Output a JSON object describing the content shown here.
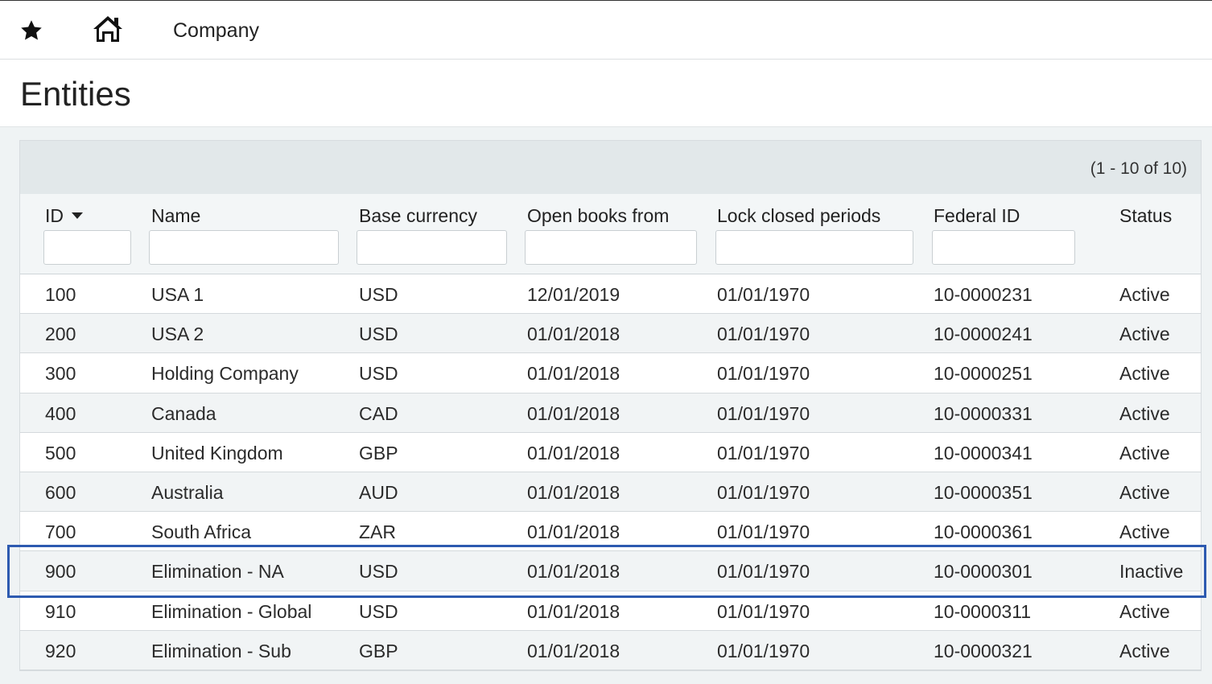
{
  "topbar": {
    "favorites_icon": "star-icon",
    "home_icon": "home-icon",
    "breadcrumb": "Company"
  },
  "page": {
    "title": "Entities"
  },
  "grid": {
    "pager_text": "(1 - 10 of 10)",
    "columns": [
      {
        "label": "ID",
        "sorted": "descending",
        "filter": true
      },
      {
        "label": "Name",
        "filter": true
      },
      {
        "label": "Base currency",
        "filter": true
      },
      {
        "label": "Open books from",
        "filter": true
      },
      {
        "label": "Lock closed periods",
        "filter": true
      },
      {
        "label": "Federal ID",
        "filter": true
      },
      {
        "label": "Status",
        "filter": false
      }
    ],
    "filters": {
      "id": "",
      "name": "",
      "base_currency": "",
      "open_books_from": "",
      "lock_closed_periods": "",
      "federal_id": ""
    },
    "rows": [
      {
        "id": "100",
        "name": "USA 1",
        "currency": "USD",
        "open": "12/01/2019",
        "lock": "01/01/1970",
        "federal_id": "10-0000231",
        "status": "Active"
      },
      {
        "id": "200",
        "name": "USA 2",
        "currency": "USD",
        "open": "01/01/2018",
        "lock": "01/01/1970",
        "federal_id": "10-0000241",
        "status": "Active"
      },
      {
        "id": "300",
        "name": "Holding Company",
        "currency": "USD",
        "open": "01/01/2018",
        "lock": "01/01/1970",
        "federal_id": "10-0000251",
        "status": "Active"
      },
      {
        "id": "400",
        "name": "Canada",
        "currency": "CAD",
        "open": "01/01/2018",
        "lock": "01/01/1970",
        "federal_id": "10-0000331",
        "status": "Active"
      },
      {
        "id": "500",
        "name": "United Kingdom",
        "currency": "GBP",
        "open": "01/01/2018",
        "lock": "01/01/1970",
        "federal_id": "10-0000341",
        "status": "Active"
      },
      {
        "id": "600",
        "name": "Australia",
        "currency": "AUD",
        "open": "01/01/2018",
        "lock": "01/01/1970",
        "federal_id": "10-0000351",
        "status": "Active"
      },
      {
        "id": "700",
        "name": "South Africa",
        "currency": "ZAR",
        "open": "01/01/2018",
        "lock": "01/01/1970",
        "federal_id": "10-0000361",
        "status": "Active"
      },
      {
        "id": "900",
        "name": "Elimination - NA",
        "currency": "USD",
        "open": "01/01/2018",
        "lock": "01/01/1970",
        "federal_id": "10-0000301",
        "status": "Inactive"
      },
      {
        "id": "910",
        "name": "Elimination - Global",
        "currency": "USD",
        "open": "01/01/2018",
        "lock": "01/01/1970",
        "federal_id": "10-0000311",
        "status": "Active"
      },
      {
        "id": "920",
        "name": "Elimination - Sub",
        "currency": "GBP",
        "open": "01/01/2018",
        "lock": "01/01/1970",
        "federal_id": "10-0000321",
        "status": "Active"
      }
    ],
    "highlighted_row_index": 7
  },
  "colors": {
    "highlight_border": "#2d5ab0",
    "pager_band": "#e2e8ea",
    "row_alt": "#f1f4f5"
  }
}
